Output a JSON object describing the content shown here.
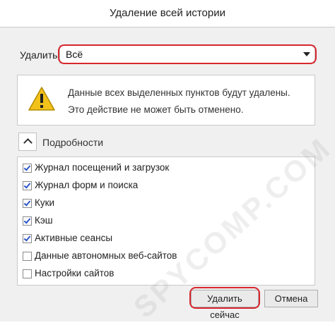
{
  "window": {
    "title": "Удаление всей истории"
  },
  "range": {
    "label": "Удалить:",
    "value": "Всё"
  },
  "warning": {
    "icon": "warning-triangle-icon",
    "line1": "Данные всех выделенных пунктов будут удалены.",
    "line2": "Это действие не может быть отменено."
  },
  "details": {
    "label": "Подробности",
    "icon": "chevron-up-icon"
  },
  "items": [
    {
      "label": "Журнал посещений и загрузок",
      "checked": true
    },
    {
      "label": "Журнал форм и поиска",
      "checked": true
    },
    {
      "label": "Куки",
      "checked": true
    },
    {
      "label": "Кэш",
      "checked": true
    },
    {
      "label": "Активные сеансы",
      "checked": true
    },
    {
      "label": "Данные автономных веб-сайтов",
      "checked": false
    },
    {
      "label": "Настройки сайтов",
      "checked": false
    }
  ],
  "buttons": {
    "clear": "Удалить сейчас",
    "cancel": "Отмена"
  },
  "watermark": "SPYCOMP.COM",
  "colors": {
    "highlight": "#d9262e",
    "checkmark": "#2d56c8",
    "warning_yellow": "#f2c21b"
  }
}
